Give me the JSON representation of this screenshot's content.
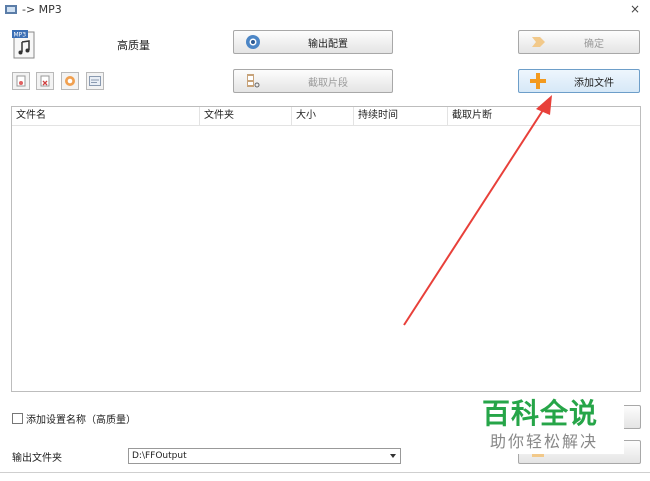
{
  "window": {
    "title": "-> MP3",
    "close_glyph": "×"
  },
  "header": {
    "preset_label": "高质量",
    "output_config_label": "输出配置",
    "ok_label": "确定",
    "clip_label": "截取片段",
    "add_file_label": "添加文件"
  },
  "toolbar_icons": [
    "remove-file-icon",
    "clear-list-icon",
    "play-icon",
    "info-icon"
  ],
  "file_list": {
    "columns": [
      "文件名",
      "文件夹",
      "大小",
      "持续时间",
      "截取片断"
    ]
  },
  "options": {
    "add_preset_name_label": "添加设置名称（高质量）",
    "output_folder_label": "输出文件夹",
    "output_folder_value": "D:\\FFOutput"
  },
  "watermark": {
    "main": "百科全说",
    "sub": "助你轻松解决"
  },
  "colors": {
    "arrow": "#e8403a",
    "add_icon": "#f39a1e",
    "watermark_green": "#26a548"
  }
}
